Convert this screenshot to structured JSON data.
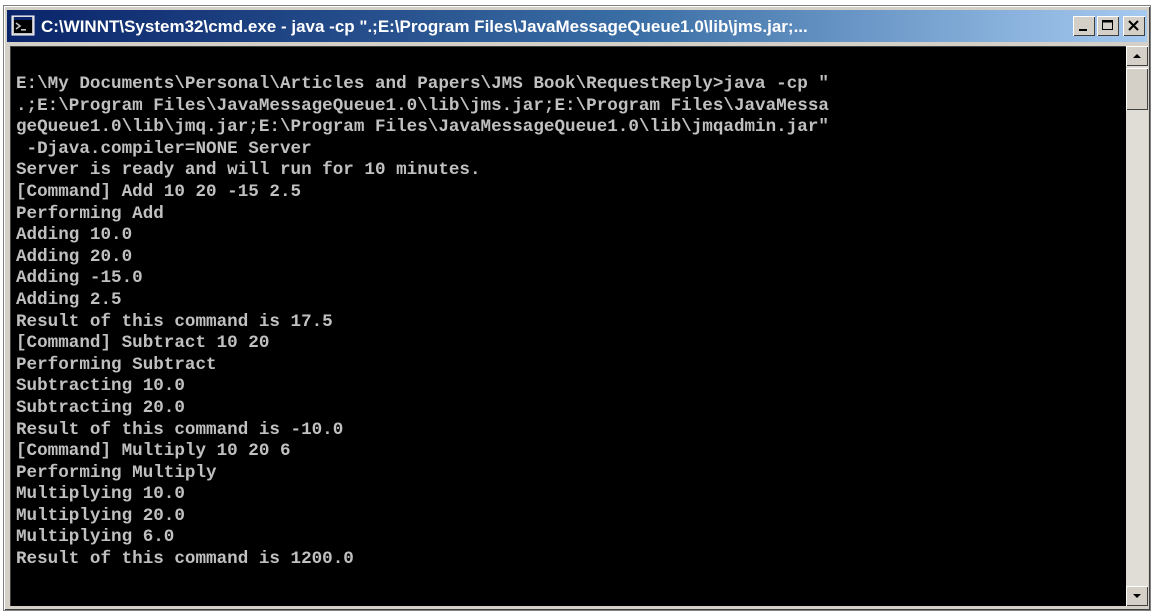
{
  "window": {
    "title": "C:\\WINNT\\System32\\cmd.exe - java -cp \".;E:\\Program Files\\JavaMessageQueue1.0\\lib\\jms.jar;..."
  },
  "icons": {
    "app": "cmd-icon",
    "minimize": "minimize-icon",
    "maximize": "maximize-icon",
    "close": "close-icon",
    "scroll_up": "scroll-up-arrow-icon",
    "scroll_down": "scroll-down-arrow-icon"
  },
  "colors": {
    "console_background": "#000000",
    "console_text": "#c0c0c0",
    "titlebar_start": "#0a246a",
    "titlebar_end": "#a6caf0"
  },
  "console": {
    "lines": [
      "E:\\My Documents\\Personal\\Articles and Papers\\JMS Book\\RequestReply>java -cp \"",
      ".;E:\\Program Files\\JavaMessageQueue1.0\\lib\\jms.jar;E:\\Program Files\\JavaMessa",
      "geQueue1.0\\lib\\jmq.jar;E:\\Program Files\\JavaMessageQueue1.0\\lib\\jmqadmin.jar\"",
      " -Djava.compiler=NONE Server",
      "Server is ready and will run for 10 minutes.",
      "[Command] Add 10 20 -15 2.5",
      "Performing Add",
      "Adding 10.0",
      "Adding 20.0",
      "Adding -15.0",
      "Adding 2.5",
      "Result of this command is 17.5",
      "[Command] Subtract 10 20",
      "Performing Subtract",
      "Subtracting 10.0",
      "Subtracting 20.0",
      "Result of this command is -10.0",
      "[Command] Multiply 10 20 6",
      "Performing Multiply",
      "Multiplying 10.0",
      "Multiplying 20.0",
      "Multiplying 6.0",
      "Result of this command is 1200.0"
    ]
  }
}
